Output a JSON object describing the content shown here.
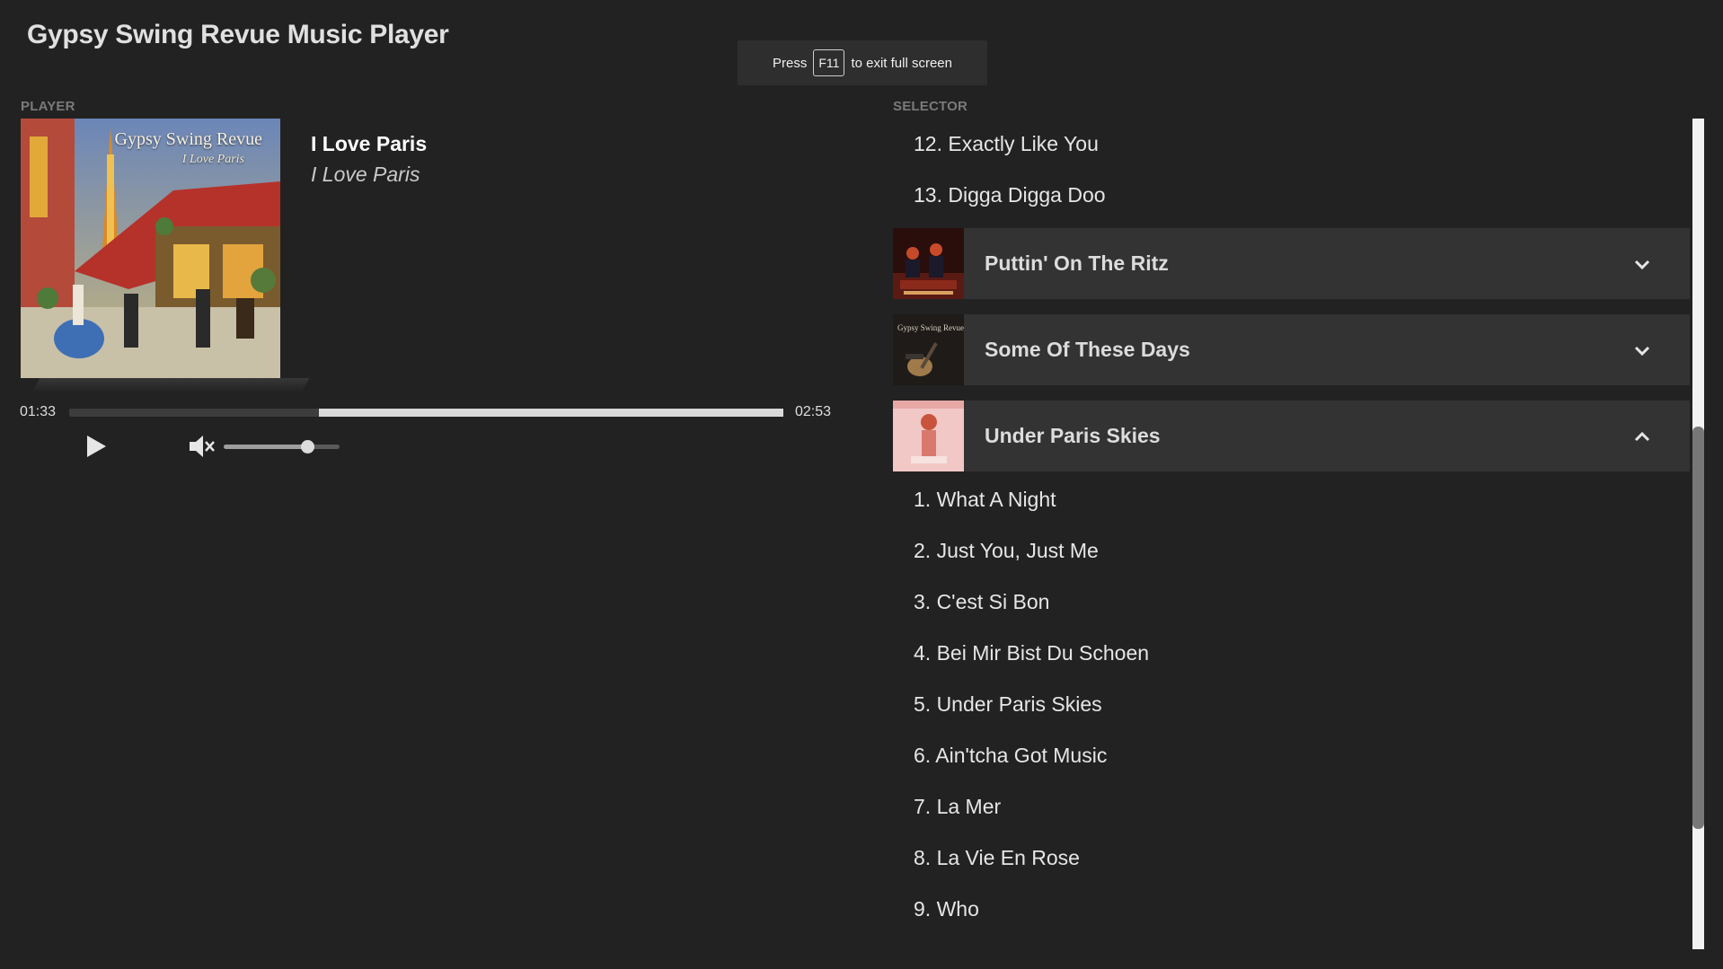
{
  "app": {
    "title": "Gypsy Swing Revue Music Player"
  },
  "fullscreen_notice": {
    "prefix": "Press",
    "key": "F11",
    "suffix": "to exit full screen"
  },
  "player": {
    "section_label": "PLAYER",
    "album_art": {
      "title": "Gypsy Swing Revue",
      "subtitle": "I Love Paris"
    },
    "track_title": "I Love Paris",
    "album_title": "I Love Paris",
    "elapsed": "01:33",
    "total": "02:53",
    "progress_played_fraction": 0.35,
    "progress_buffered_from_fraction": 0.35,
    "volume_fraction": 0.72,
    "controls": {
      "play": "play-icon",
      "mute": "volume-muted-icon"
    }
  },
  "selector": {
    "section_label": "SELECTOR",
    "prev_songs": [
      {
        "label": "12. Exactly Like You"
      },
      {
        "label": "13. Digga Digga Doo"
      }
    ],
    "albums": [
      {
        "name": "Puttin' On The Ritz",
        "expanded": false,
        "chevron": "chevron-down-icon"
      },
      {
        "name": "Some Of These Days",
        "expanded": false,
        "chevron": "chevron-down-icon"
      },
      {
        "name": "Under Paris Skies",
        "expanded": true,
        "chevron": "chevron-up-icon"
      }
    ],
    "songs": [
      {
        "label": "1. What A Night"
      },
      {
        "label": "2. Just You, Just Me"
      },
      {
        "label": "3. C'est Si Bon"
      },
      {
        "label": "4. Bei Mir Bist Du Schoen"
      },
      {
        "label": "5. Under Paris Skies"
      },
      {
        "label": "6. Ain'tcha Got Music"
      },
      {
        "label": "7. La Mer"
      },
      {
        "label": "8. La Vie En Rose"
      },
      {
        "label": "9. Who"
      }
    ]
  },
  "colors": {
    "background": "#222222",
    "row": "#333333",
    "accent": "#d9d9d9"
  }
}
